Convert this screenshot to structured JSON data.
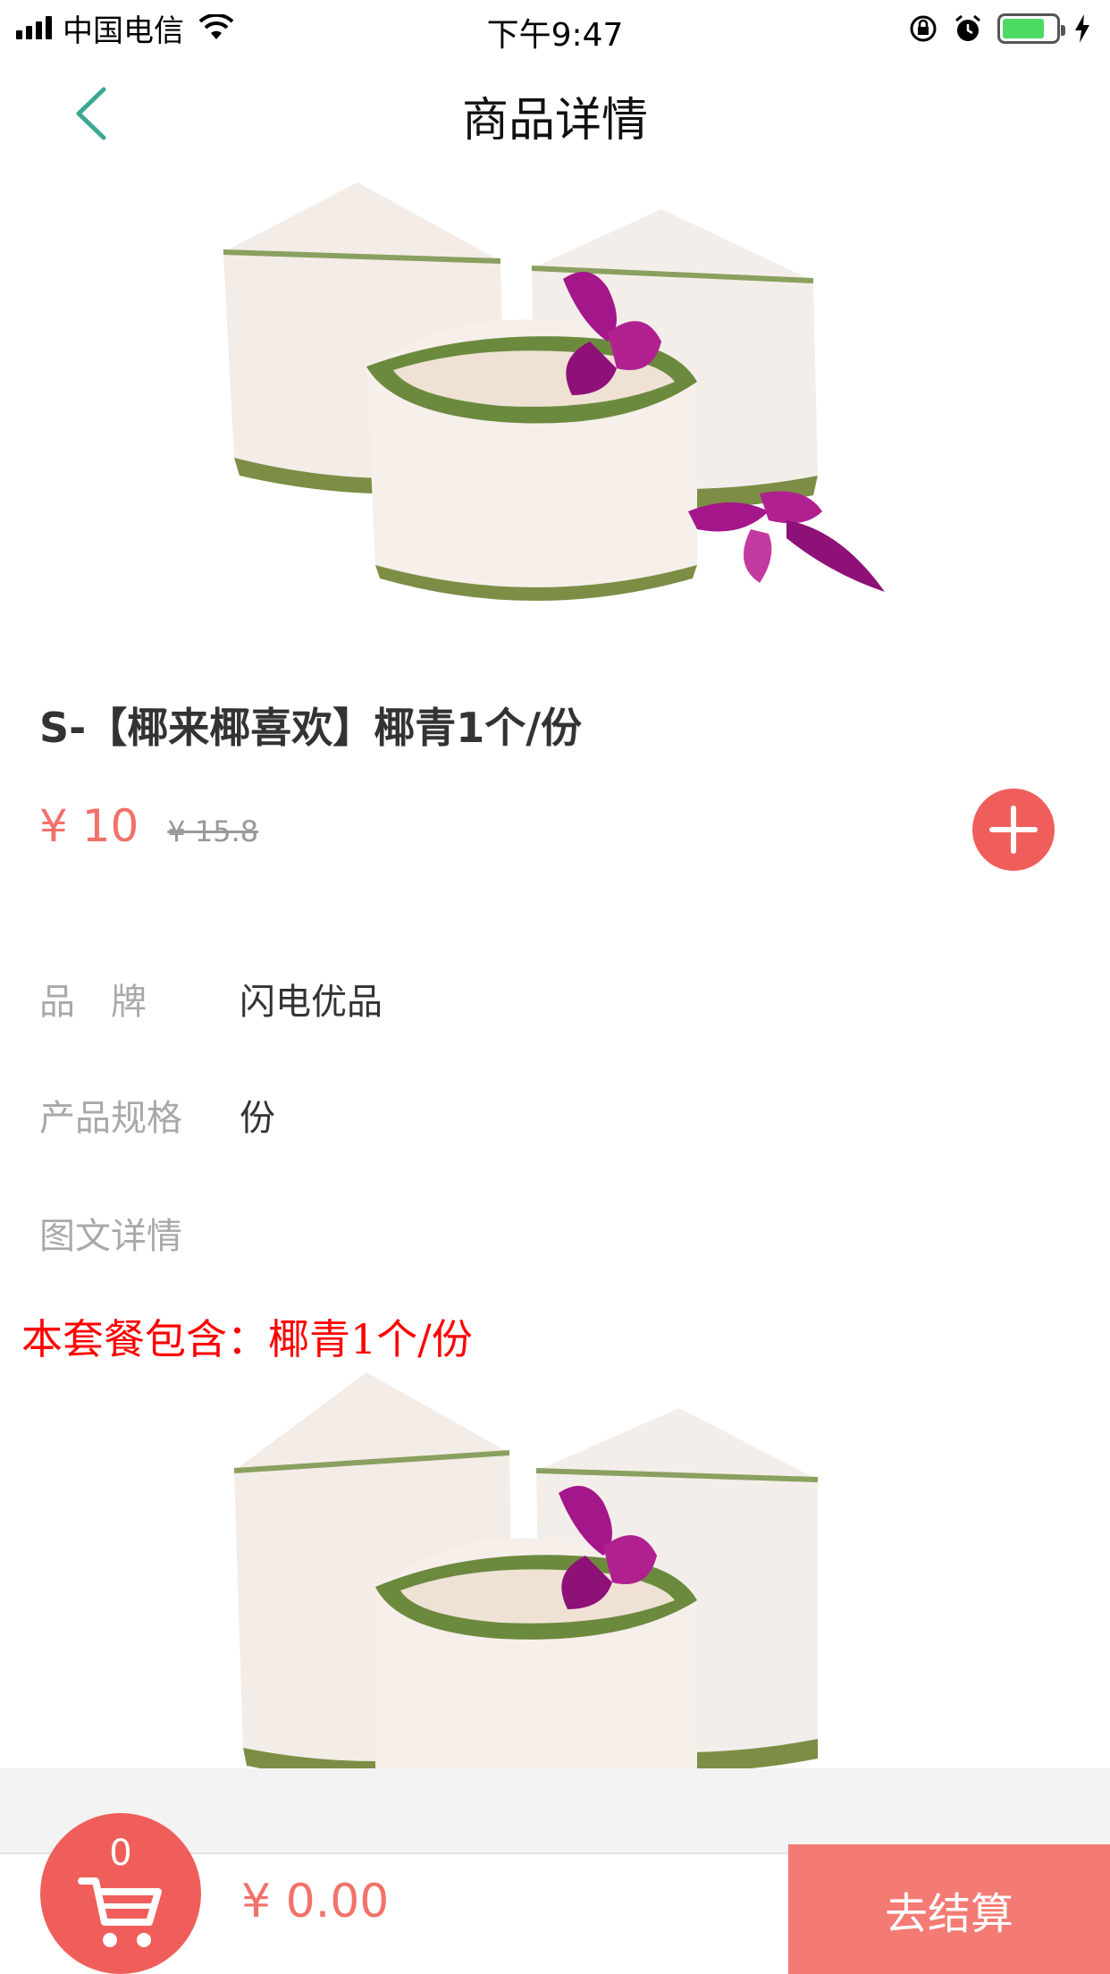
{
  "status_bar": {
    "carrier": "中国电信",
    "time": "下午9:47"
  },
  "nav": {
    "title": "商品详情",
    "back_icon": "chevron-left-icon"
  },
  "product": {
    "name": "S-【椰来椰喜欢】椰青1个/份",
    "price": "¥ 10",
    "original_price": "¥ 15.8",
    "add_icon": "plus-icon"
  },
  "details": {
    "brand_label": "品　牌",
    "brand_value": "闪电优品",
    "spec_label": "产品规格",
    "spec_value": "份",
    "detail_label": "图文详情",
    "package_text": "本套餐包含：椰青1个/份"
  },
  "cart": {
    "count": "0",
    "total": "¥ 0.00",
    "checkout_label": "去结算",
    "icon": "cart-icon"
  },
  "colors": {
    "accent": "#f05e5b",
    "price": "#f2726a",
    "back_arrow": "#3aa893"
  }
}
